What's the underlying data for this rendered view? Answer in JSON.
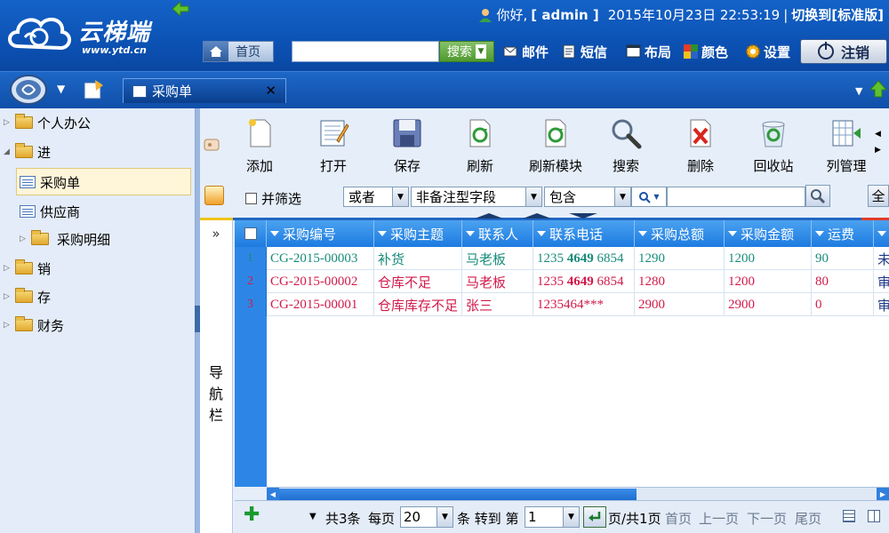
{
  "app": {
    "logo_title": "云梯端",
    "logo_url": "www.ytd.cn"
  },
  "user_bar": {
    "greeting": "你好,",
    "username": "[ admin ]",
    "datetime": "2015年10月23日  22:53:19",
    "switch_label": "切换到[标准版]"
  },
  "header": {
    "home_label": "首页",
    "search_placeholder": "",
    "search_button": "搜索",
    "tools": [
      {
        "label": "邮件",
        "icon": "mail-icon"
      },
      {
        "label": "短信",
        "icon": "sms-icon"
      },
      {
        "label": "布局",
        "icon": "layout-icon"
      },
      {
        "label": "颜色",
        "icon": "color-icon"
      },
      {
        "label": "设置",
        "icon": "gear-icon"
      }
    ],
    "logout_label": "注销"
  },
  "tabs": {
    "active": "采购单"
  },
  "sidebar": {
    "items": [
      {
        "label": "个人办公",
        "type": "folder"
      },
      {
        "label": "进",
        "type": "folder-open"
      },
      {
        "label": "采购单",
        "type": "doc"
      },
      {
        "label": "供应商",
        "type": "doc"
      },
      {
        "label": "采购明细",
        "type": "folder"
      },
      {
        "label": "销",
        "type": "folder"
      },
      {
        "label": "存",
        "type": "folder"
      },
      {
        "label": "财务",
        "type": "folder"
      }
    ]
  },
  "toolbar": {
    "buttons": [
      {
        "label": "添加",
        "icon": "add-doc-icon"
      },
      {
        "label": "打开",
        "icon": "open-edit-icon"
      },
      {
        "label": "保存",
        "icon": "save-icon"
      },
      {
        "label": "刷新",
        "icon": "refresh-icon"
      },
      {
        "label": "刷新模块",
        "icon": "refresh-module-icon"
      },
      {
        "label": "搜索",
        "icon": "magnifier-icon"
      },
      {
        "label": "删除",
        "icon": "delete-icon"
      },
      {
        "label": "回收站",
        "icon": "recycle-bin-icon"
      },
      {
        "label": "列管理",
        "icon": "column-manage-icon"
      }
    ]
  },
  "filter": {
    "parallel_label": "并筛选",
    "logic_value": "或者",
    "field_value": "非备注型字段",
    "op_value": "包含",
    "search_value": "",
    "all_label": "全"
  },
  "nav_strip": {
    "toggle": "»",
    "label": "导航栏"
  },
  "grid": {
    "columns": [
      "采购编号",
      "采购主题",
      "联系人",
      "联系电话",
      "采购总额",
      "采购金额",
      "运费"
    ],
    "rows": [
      {
        "index": "1",
        "code": "CG-2015-00003",
        "subject": "补货",
        "contact": "马老板",
        "phone_a": "1235 ",
        "phone_b": "4649",
        "phone_c": " 6854",
        "total": "1290",
        "amount": "1200",
        "freight": "90",
        "status": "未",
        "color": "green"
      },
      {
        "index": "2",
        "code": "CG-2015-00002",
        "subject": "仓库不足",
        "contact": "马老板",
        "phone_a": "1235 ",
        "phone_b": "4649",
        "phone_c": " 6854",
        "total": "1280",
        "amount": "1200",
        "freight": "80",
        "status": "审",
        "color": "red"
      },
      {
        "index": "3",
        "code": "CG-2015-00001",
        "subject": "仓库库存不足",
        "contact": "张三",
        "phone_a": "1235464***",
        "phone_b": "",
        "phone_c": "",
        "total": "2900",
        "amount": "2900",
        "freight": "0",
        "status": "审",
        "color": "red"
      }
    ]
  },
  "pager": {
    "total": "共3条",
    "per_page_label": "每页",
    "per_page": "20",
    "goto_label": "条 转到 第",
    "page": "1",
    "of_pages": "页/共1页",
    "first": "首页",
    "prev": "上一页",
    "next": "下一页",
    "last": "尾页"
  }
}
